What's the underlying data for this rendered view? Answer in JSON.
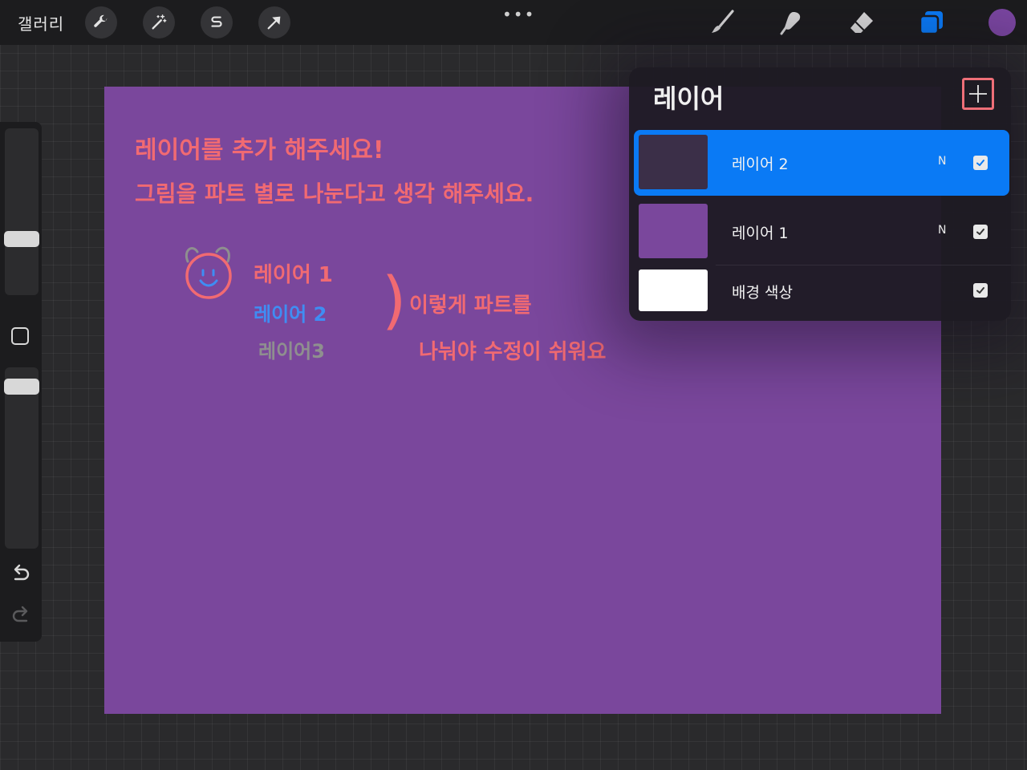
{
  "topbar": {
    "gallery_label": "갤러리",
    "more_dots": "•••",
    "left_tools": [
      "wrench-icon",
      "magic-wand-icon",
      "selection-s-icon",
      "arrow-icon"
    ],
    "right_tools": [
      "brush-icon",
      "smudge-icon",
      "eraser-icon",
      "layers-icon"
    ],
    "current_color": "#7a46a0",
    "accent_color": "#0a7af5"
  },
  "canvas": {
    "background_color": "#7a479c",
    "notes": {
      "line1": "레이어를  추가 해주세요!",
      "line2": "그림을  파트 별로  나눈다고  생각 해주세요.",
      "layer1_label": "레이어 1",
      "layer2_label": "레이어 2",
      "layer3_label": "레이어3",
      "bracket": ")",
      "explain1": "이렇게  파트를",
      "explain2": "나눠야   수정이  쉬워요"
    },
    "colors": {
      "pink": "#f16a72",
      "blue": "#3f8df3",
      "gray": "#8f8f8f"
    }
  },
  "layers_panel": {
    "title": "레이어",
    "add_button_icon": "plus-icon",
    "layers": [
      {
        "name": "레이어 2",
        "blend": "N",
        "visible": true,
        "active": true,
        "thumb_color": "#3b2f48"
      },
      {
        "name": "레이어 1",
        "blend": "N",
        "visible": true,
        "active": false,
        "thumb_color": "#7a479c"
      },
      {
        "name": "배경 색상",
        "blend": "",
        "visible": true,
        "active": false,
        "thumb_color": "#ffffff"
      }
    ]
  }
}
